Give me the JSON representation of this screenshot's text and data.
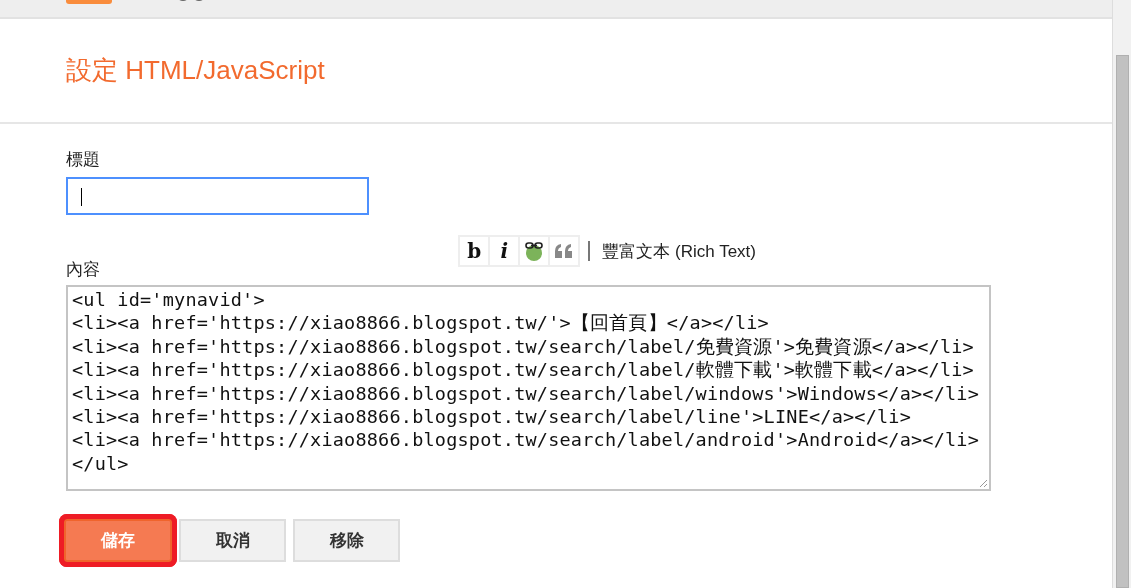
{
  "dialog": {
    "title": "設定 HTML/JavaScript"
  },
  "title_field": {
    "label": "標題",
    "focused": true
  },
  "content": {
    "label": "內容",
    "toolbar": [
      {
        "kind": "bold",
        "label": "b"
      },
      {
        "kind": "italic",
        "label": "i"
      },
      {
        "kind": "link"
      },
      {
        "kind": "quote"
      }
    ],
    "rich_text_link": "豐富文本 (Rich Text)",
    "lines": [
      "<ul id='mynavid'>",
      "<li><a href='https://xiao8866.blogspot.tw/'>【回首頁】</a></li>",
      "<li><a href='https://xiao8866.blogspot.tw/search/label/免費資源'>免費資源</a></li>",
      "<li><a href='https://xiao8866.blogspot.tw/search/label/軟體下載'>軟體下載</a></li>",
      "<li><a href='https://xiao8866.blogspot.tw/search/label/windows'>Windows</a></li>",
      "<li><a href='https://xiao8866.blogspot.tw/search/label/line'>LINE</a></li>",
      "<li><a href='https://xiao8866.blogspot.tw/search/label/android'>Android</a></li>",
      "</ul>"
    ]
  },
  "buttons": [
    {
      "label": "儲存",
      "kind": "primary",
      "highlighted": true
    },
    {
      "label": "取消",
      "kind": "secondary",
      "highlighted": false
    },
    {
      "label": "移除",
      "kind": "secondary",
      "highlighted": false
    }
  ]
}
